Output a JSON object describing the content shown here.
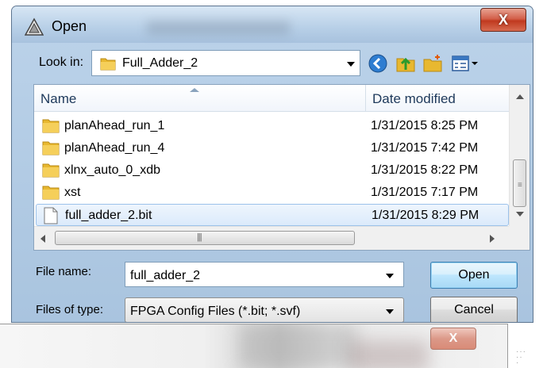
{
  "window": {
    "title": "Open",
    "close_label": "X"
  },
  "lookin": {
    "label": "Look in:",
    "value": "Full_Adder_2"
  },
  "toolbar": {
    "icons": [
      "back-icon",
      "up-folder-icon",
      "new-folder-icon",
      "view-menu-icon"
    ]
  },
  "list": {
    "columns": {
      "name": "Name",
      "date": "Date modified"
    },
    "rows": [
      {
        "name": "planAhead_run_1",
        "date": "1/31/2015 8:25 PM",
        "type": "folder"
      },
      {
        "name": "planAhead_run_4",
        "date": "1/31/2015 7:42 PM",
        "type": "folder"
      },
      {
        "name": "xlnx_auto_0_xdb",
        "date": "1/31/2015 8:22 PM",
        "type": "folder"
      },
      {
        "name": "xst",
        "date": "1/31/2015 7:17 PM",
        "type": "folder"
      },
      {
        "name": "full_adder_2.bit",
        "date": "1/31/2015 8:29 PM",
        "type": "file",
        "selected": true
      }
    ]
  },
  "form": {
    "filename_label": "File name:",
    "filename_value": "full_adder_2",
    "filetype_label": "Files of type:",
    "filetype_value": "FPGA Config Files (*.bit; *.svf)"
  },
  "buttons": {
    "open": "Open",
    "cancel": "Cancel"
  },
  "second_window": {
    "close_label": "X"
  },
  "colors": {
    "title_gradient_top": "#d7e6f4",
    "close_red": "#c0391f",
    "selection": "#dbeafb",
    "folder_yellow": "#e8b830"
  }
}
